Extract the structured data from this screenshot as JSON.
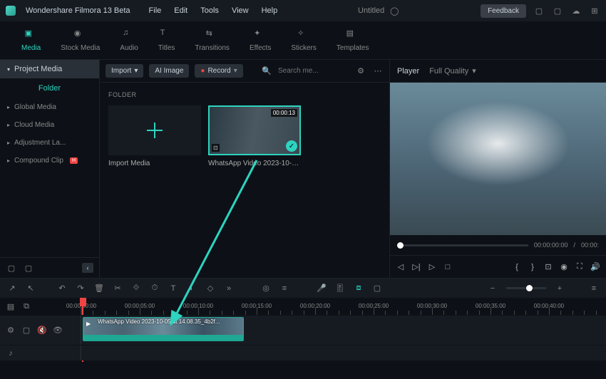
{
  "titlebar": {
    "app": "Wondershare Filmora 13 Beta",
    "menus": [
      "File",
      "Edit",
      "Tools",
      "View",
      "Help"
    ],
    "project": "Untitled",
    "feedback": "Feedback"
  },
  "tabs": [
    {
      "label": "Media",
      "active": true
    },
    {
      "label": "Stock Media"
    },
    {
      "label": "Audio"
    },
    {
      "label": "Titles"
    },
    {
      "label": "Transitions"
    },
    {
      "label": "Effects"
    },
    {
      "label": "Stickers"
    },
    {
      "label": "Templates"
    }
  ],
  "sidebar": {
    "header": "Project Media",
    "folder_label": "Folder",
    "items": [
      {
        "label": "Global Media"
      },
      {
        "label": "Cloud Media"
      },
      {
        "label": "Adjustment La..."
      },
      {
        "label": "Compound Clip",
        "hot": true
      }
    ]
  },
  "content_toolbar": {
    "import": "Import",
    "ai_image": "AI Image",
    "record": "Record",
    "search_placeholder": "Search me..."
  },
  "content": {
    "folder_label": "FOLDER",
    "import_label": "Import Media",
    "media_items": [
      {
        "name": "WhatsApp Video 2023-10-05...",
        "duration": "00:00:13"
      }
    ]
  },
  "player": {
    "heading": "Player",
    "quality": "Full Quality",
    "time_current": "00:00:00:00",
    "time_total": "00:00:"
  },
  "ruler": {
    "marks": [
      "00:00:00:00",
      "00:00:05:00",
      "00:00:10:00",
      "00:00:15:00",
      "00:00:20:00",
      "00:00:25:00",
      "00:00:30:00",
      "00:00:35:00",
      "00:00:40:00"
    ]
  },
  "clip": {
    "name": "WhatsApp Video 2023-10-05 at 14.08.35_4b2f..."
  }
}
